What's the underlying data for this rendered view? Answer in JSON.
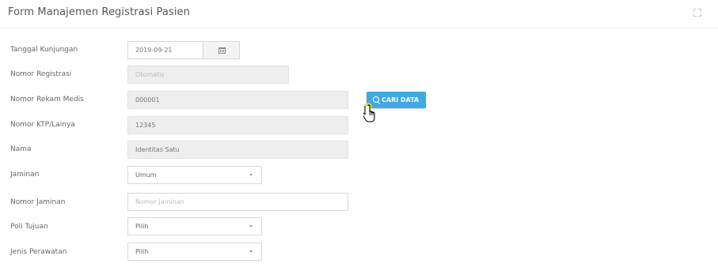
{
  "header": {
    "title": "Form Manajemen Registrasi Pasien"
  },
  "form": {
    "tanggal_kunjungan": {
      "label": "Tanggal Kunjungan",
      "value": "2019-09-21"
    },
    "nomor_registrasi": {
      "label": "Nomor Registrasi",
      "placeholder": "Otomatis"
    },
    "nomor_rekam_medis": {
      "label": "Nomor Rekam Medis",
      "value": "000001"
    },
    "nomor_ktp": {
      "label": "Nomor KTP/Lainya",
      "value": "12345"
    },
    "nama": {
      "label": "Nama",
      "value": "Identitas Satu"
    },
    "jaminan": {
      "label": "Jaminan",
      "value": "Umum"
    },
    "nomor_jaminan": {
      "label": "Nomor Jaminan",
      "placeholder": "Nomor Jaminan"
    },
    "poli_tujuan": {
      "label": "Poli Tujuan",
      "value": "Pilih"
    },
    "jenis_perawatan": {
      "label": "Jenis Perawatan",
      "value": "Pilih"
    }
  },
  "buttons": {
    "cari_data": "CARI DATA"
  },
  "colors": {
    "accent": "#3fa9e0",
    "readonly_bg": "#eeeeee"
  }
}
